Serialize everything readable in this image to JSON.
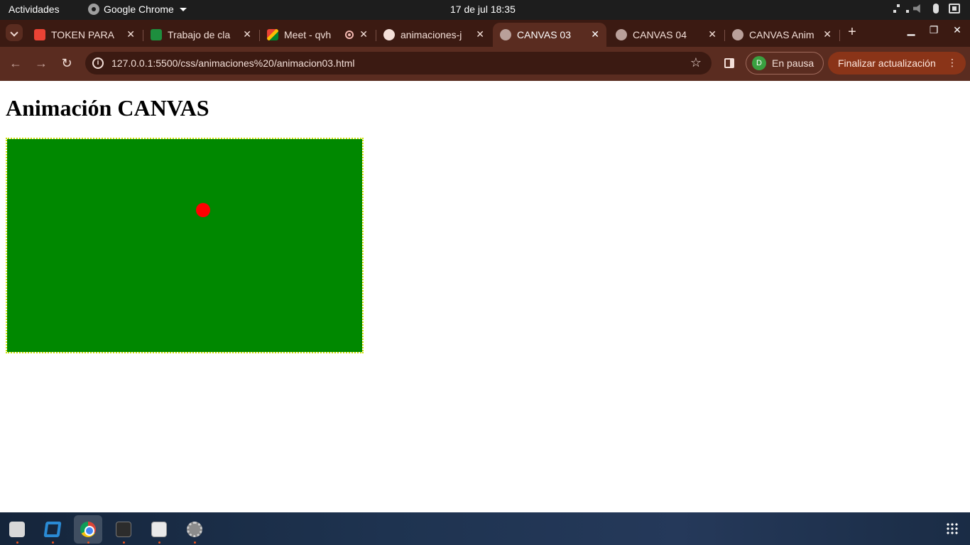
{
  "topbar": {
    "activities": "Actividades",
    "app_name": "Google Chrome",
    "clock": "17 de jul  18:35"
  },
  "tabs": [
    {
      "title": "TOKEN PARA",
      "favicon": "gmail-icon",
      "color": "#ea4335"
    },
    {
      "title": "Trabajo de cla",
      "favicon": "classroom-icon",
      "color": "#1e8e3e"
    },
    {
      "title": "Meet - qvh",
      "favicon": "meet-icon",
      "color": "#00832d",
      "recording": true
    },
    {
      "title": "animaciones-j",
      "favicon": "github-icon",
      "color": "#f3dfd8"
    },
    {
      "title": "CANVAS 03",
      "favicon": "globe-icon",
      "active": true
    },
    {
      "title": "CANVAS 04",
      "favicon": "globe-icon"
    },
    {
      "title": "CANVAS Anim",
      "favicon": "globe-icon"
    }
  ],
  "toolbar": {
    "url": "127.0.0.1:5500/css/animaciones%20/animacion03.html",
    "profile_initial": "D",
    "profile_label": "En pausa",
    "update_label": "Finalizar actualización"
  },
  "page": {
    "heading": "Animación CANVAS",
    "canvas_bg": "#008800",
    "canvas_border": "#c8e000",
    "ball_color": "#ff0000"
  },
  "dock": {
    "apps": [
      "files-icon",
      "vscode-icon",
      "chrome-icon",
      "terminal-icon",
      "image-viewer-icon",
      "settings-icon"
    ]
  }
}
